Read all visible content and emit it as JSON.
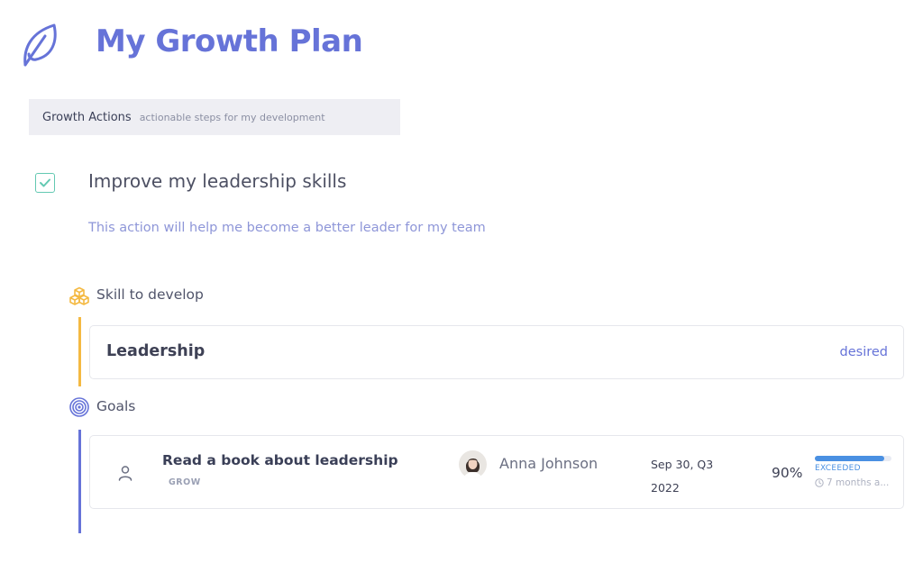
{
  "header": {
    "logo_icon": "leaf-icon",
    "title": "My Growth Plan"
  },
  "section": {
    "title": "Growth Actions",
    "subtitle": "actionable steps for my development"
  },
  "action": {
    "checked": true,
    "title": "Improve my leadership skills",
    "description": "This action will help me become a better leader for my team"
  },
  "skill": {
    "icon": "cubes-icon",
    "heading": "Skill to develop",
    "name": "Leadership",
    "level": "desired"
  },
  "goals": {
    "icon": "target-icon",
    "heading": "Goals",
    "items": [
      {
        "icon": "person-icon",
        "title": "Read a book about leadership",
        "tag": "GROW",
        "owner": "Anna Johnson",
        "date_line1": "Sep 30, Q3",
        "date_line2": "2022",
        "percent": "90%",
        "progress": 0.9,
        "status": "EXCEEDED",
        "updated": "7 months a..."
      }
    ]
  },
  "colors": {
    "accent": "#6673d8",
    "skill_line": "#f4b942",
    "check": "#63c9b2",
    "progress": "#4a90e2"
  }
}
